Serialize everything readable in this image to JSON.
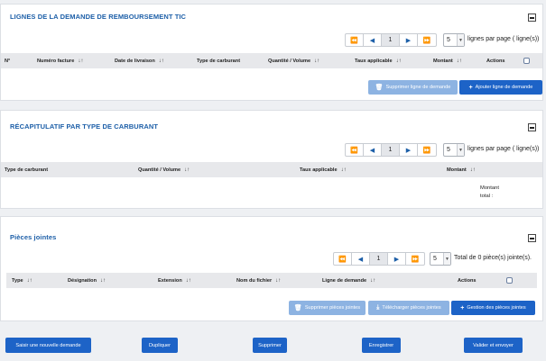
{
  "pager_buttons": {
    "first": "⏪",
    "prev": "◀",
    "next": "▶",
    "last": "⏩"
  },
  "lines_panel": {
    "title": "LIGNES DE LA DEMANDE DE REMBOURSEMENT TIC",
    "current_page": "1",
    "page_size": "5",
    "per_page_label": "lignes par page ( ligne(s))",
    "columns": [
      "N°",
      "Numéro facture",
      "Date de livraison",
      "Type de carburant",
      "Quantité / Volume",
      "Taux applicable",
      "Montant",
      "Actions"
    ],
    "delete_button": "Supprimer ligne de demande",
    "add_button": "Ajouter ligne de demande"
  },
  "summary_panel": {
    "title": "RÉCAPITULATIF PAR TYPE DE CARBURANT",
    "current_page": "1",
    "page_size": "5",
    "per_page_label": "lignes par page ( ligne(s))",
    "columns": [
      "Type de carburant",
      "Quantité / Volume",
      "Taux applicable",
      "Montant"
    ],
    "total_label_line1": "Montant",
    "total_label_line2": "total :"
  },
  "attachments_panel": {
    "title": "Pièces jointes",
    "current_page": "1",
    "page_size": "5",
    "per_page_label": "Total de 0 pièce(s) jointe(s).",
    "columns": [
      "Type",
      "Désignation",
      "Extension",
      "Nom du fichier",
      "Ligne de demande",
      "Actions"
    ],
    "delete_button": "Supprimer pièces jointes",
    "download_button": "Télécharger pièces jointes",
    "manage_button": "Gestion des pièces jointes"
  },
  "footer": {
    "new_request": "Saisir une nouvelle demande",
    "duplicate": "Dupliquer",
    "delete": "Supprimer",
    "save": "Enregistrer",
    "validate_send": "Valider et envoyer"
  },
  "colors": {
    "accent": "#1d63c7",
    "title": "#1d5fa8",
    "disabled": "#8db3e2"
  }
}
